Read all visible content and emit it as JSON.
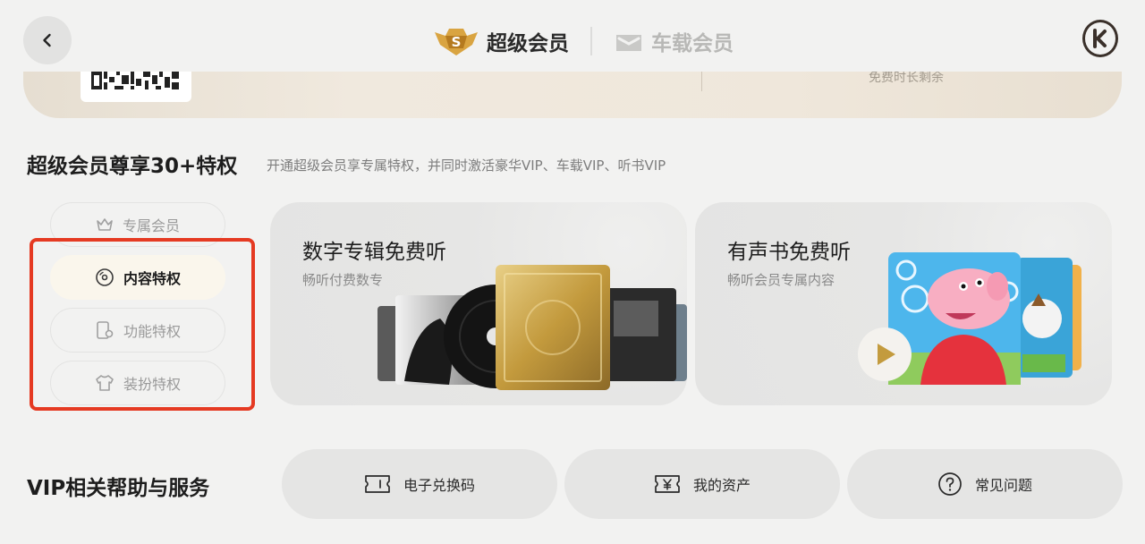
{
  "header": {
    "tabs": [
      {
        "label": "超级会员",
        "icon": "super-member-badge-icon",
        "badge_letter": "S",
        "active": true
      },
      {
        "label": "车载会员",
        "icon": "car-member-icon",
        "active": false
      }
    ]
  },
  "member_card": {
    "remaining_label": "免费时长剩余"
  },
  "privileges": {
    "title": "超级会员尊享30+特权",
    "subtitle": "开通超级会员享专属特权，并同时激活豪华VIP、车载VIP、听书VIP",
    "nav": [
      {
        "label": "专属会员",
        "icon": "crown-icon",
        "active": false
      },
      {
        "label": "内容特权",
        "icon": "vinyl-disc-icon",
        "active": true
      },
      {
        "label": "功能特权",
        "icon": "device-icon",
        "active": false
      },
      {
        "label": "装扮特权",
        "icon": "shirt-icon",
        "active": false
      }
    ],
    "cards": [
      {
        "title": "数字专辑免费听",
        "subtitle": "畅听付费数专"
      },
      {
        "title": "有声书免费听",
        "subtitle": "畅听会员专属内容"
      }
    ]
  },
  "help": {
    "title": "VIP相关帮助与服务",
    "buttons": [
      {
        "label": "电子兑换码",
        "icon": "ticket-icon"
      },
      {
        "label": "我的资产",
        "icon": "yen-wallet-icon"
      },
      {
        "label": "常见问题",
        "icon": "question-icon"
      }
    ]
  },
  "colors": {
    "accent_gold": "#d9a441",
    "highlight_red": "#e53a22",
    "background": "#f2f2f1"
  }
}
